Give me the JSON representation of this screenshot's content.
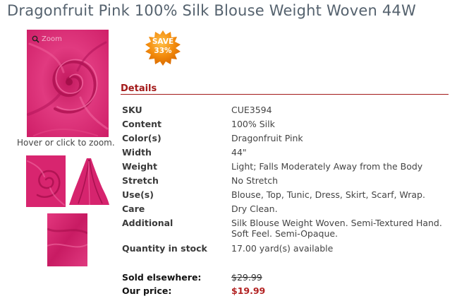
{
  "title": "Dragonfruit Pink 100% Silk Blouse Weight Woven 44W",
  "gallery": {
    "zoom_label": "Zoom",
    "zoom_hint": "Hover or click to zoom."
  },
  "badge": {
    "line1": "SAVE",
    "line2": "33%"
  },
  "details": {
    "heading": "Details",
    "rows": [
      {
        "label": "SKU",
        "value": "CUE3594"
      },
      {
        "label": "Content",
        "value": "100% Silk"
      },
      {
        "label": "Color(s)",
        "value": "Dragonfruit Pink"
      },
      {
        "label": "Width",
        "value": "44\""
      },
      {
        "label": "Weight",
        "value": "Light; Falls Moderately Away from the Body"
      },
      {
        "label": "Stretch",
        "value": "No Stretch"
      },
      {
        "label": "Use(s)",
        "value": "Blouse, Top, Tunic, Dress, Skirt, Scarf, Wrap."
      },
      {
        "label": "Care",
        "value": "Dry Clean."
      },
      {
        "label": "Additional",
        "value_line1": "Silk Blouse Weight Woven. Semi-Textured Hand.",
        "value_line2": "Soft Feel. Semi-Opaque."
      },
      {
        "label": "Quantity in stock",
        "value": "17.00 yard(s) available"
      }
    ]
  },
  "pricing": {
    "sold_elsewhere_label": "Sold elsewhere:",
    "sold_elsewhere_price": "$29.99",
    "our_price_label": "Our price:",
    "our_price": "$19.99"
  },
  "colors": {
    "fabric": "#d6246e",
    "accent": "#a31919",
    "badge": "#f28a0c"
  }
}
